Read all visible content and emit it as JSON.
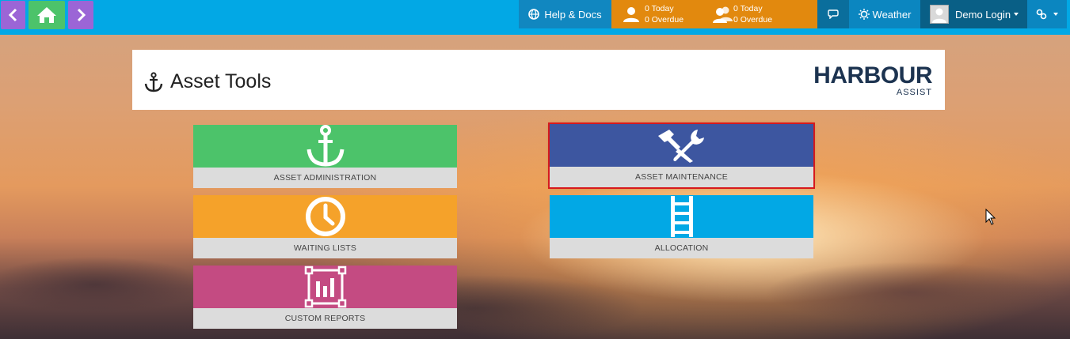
{
  "nav": {
    "prev_icon": "chevron-left-icon",
    "home_icon": "home-icon",
    "next_icon": "chevron-right-icon"
  },
  "topbar": {
    "help_label": "Help & Docs",
    "tasks_mine": {
      "today": "0 Today",
      "overdue": "0 Overdue"
    },
    "tasks_team": {
      "today": "0 Today",
      "overdue": "0 Overdue"
    },
    "weather_label": "Weather",
    "login_label": "Demo Login"
  },
  "page": {
    "title": "Asset Tools",
    "logo_main": "HARBOUR",
    "logo_sub": "ASSIST"
  },
  "tiles": [
    {
      "label": "ASSET ADMINISTRATION",
      "icon": "anchor-icon",
      "color": "#4cc36a"
    },
    {
      "label": "ASSET MAINTENANCE",
      "icon": "tools-icon",
      "color": "#3d56a0",
      "selected": true
    },
    {
      "label": "WAITING LISTS",
      "icon": "clock-icon",
      "color": "#f5a22a"
    },
    {
      "label": "ALLOCATION",
      "icon": "ladder-icon",
      "color": "#02a8e5"
    },
    {
      "label": "CUSTOM REPORTS",
      "icon": "report-icon",
      "color": "#c44b82"
    }
  ],
  "colors": {
    "topbar": "#02a8e5",
    "nav_purple": "#9b65d6",
    "nav_green": "#4cc36a",
    "tasks_orange": "#e2890e",
    "selection_outline": "#d7191c"
  }
}
